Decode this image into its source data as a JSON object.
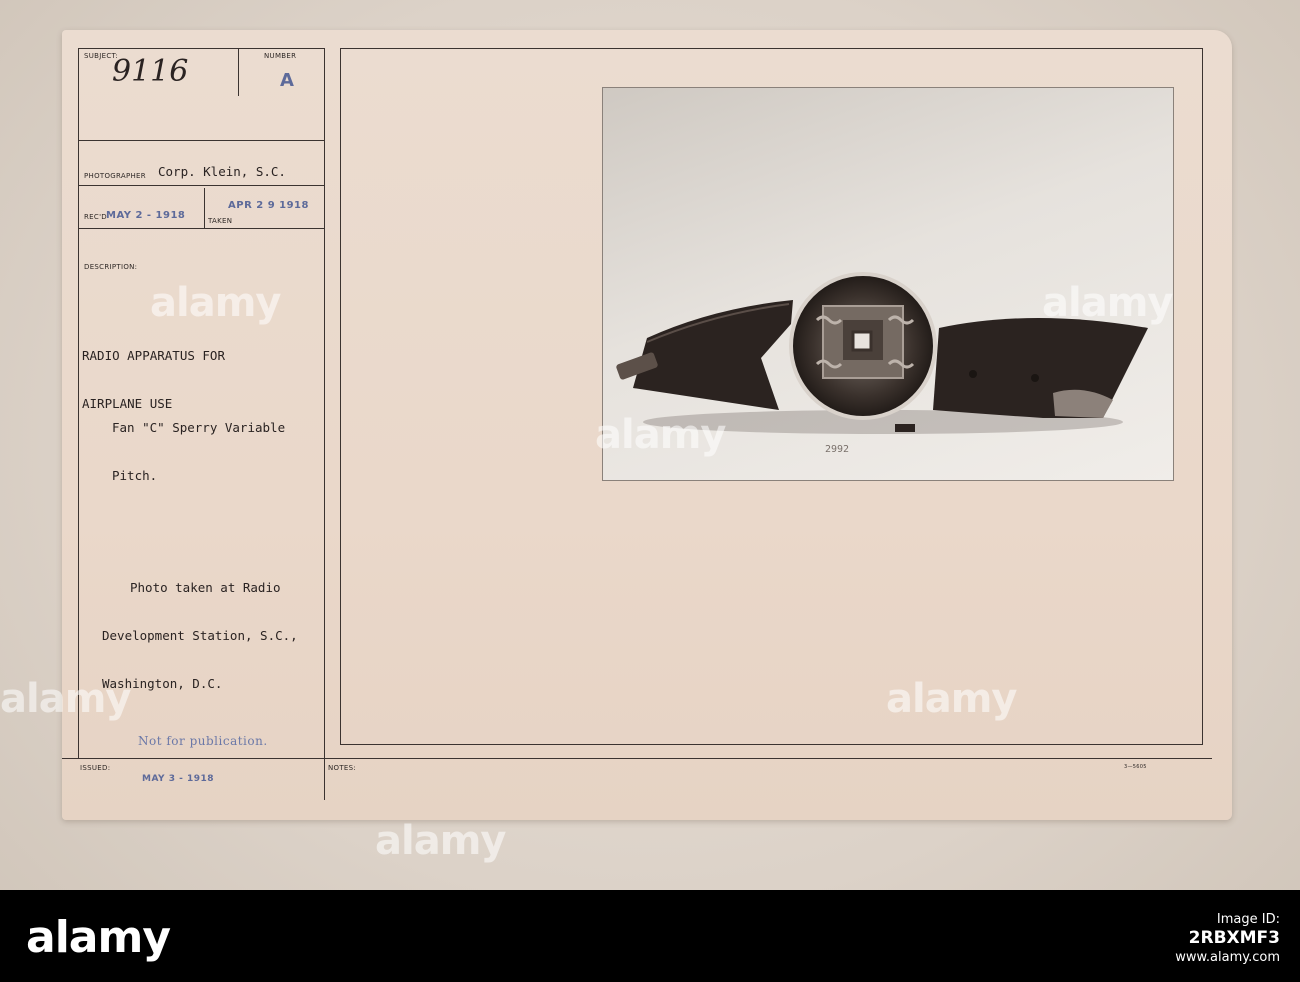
{
  "card": {
    "subject_label": "SUBJECT:",
    "subject_value": "9116",
    "number_label": "NUMBER",
    "number_value": "A",
    "photographer_label": "PHOTOGRAPHER",
    "photographer_value": "Corp. Klein, S.C.",
    "received_label": "REC'D",
    "received_value": "MAY 2 - 1918",
    "taken_label": "TAKEN",
    "taken_value": "APR 2 9 1918",
    "description_label": "DESCRIPTION:",
    "description_lines": [
      "RADIO APPARATUS FOR",
      "AIRPLANE USE"
    ],
    "detail_lines": [
      "Fan \"C\" Sperry Variable",
      "Pitch."
    ],
    "location_lines": [
      "Photo taken at Radio",
      "Development Station, S.C.,",
      "Washington, D.C."
    ],
    "restriction_stamp": "Not for publication.",
    "issued_label": "ISSUED:",
    "issued_value": "MAY 3 - 1918",
    "notes_label": "NOTES:",
    "form_code": "3—5605",
    "photo_number": "2992"
  },
  "watermark": {
    "brand": "alamy"
  },
  "footer": {
    "brand": "alamy",
    "image_id_label": "Image ID:",
    "image_id": "2RBXMF3",
    "site": "www.alamy.com"
  }
}
